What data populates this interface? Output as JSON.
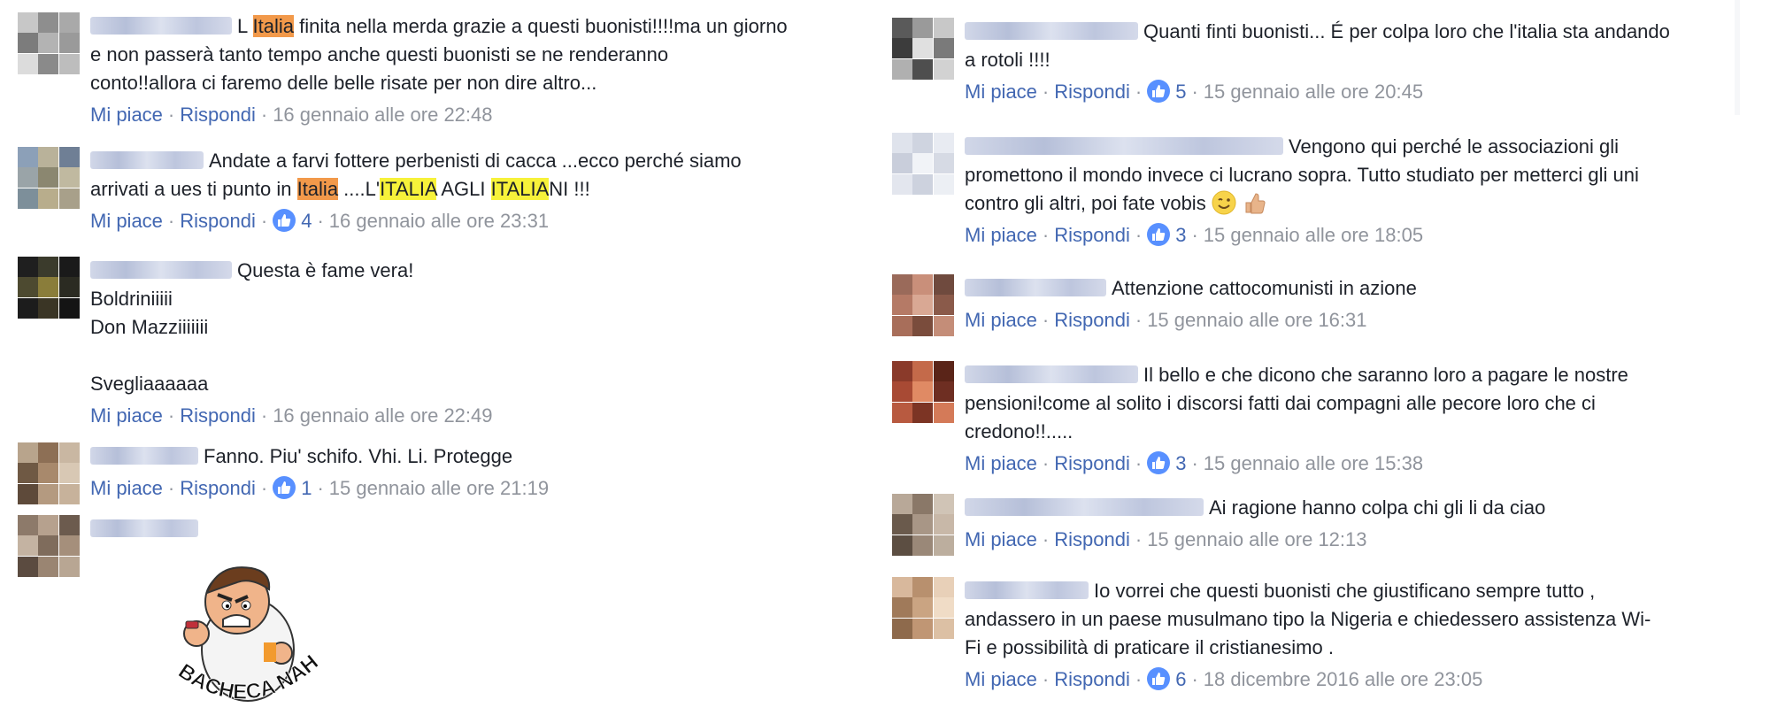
{
  "colors": {
    "link": "#4267b2",
    "meta": "#90949c",
    "like_badge": "#5890ff",
    "highlight_orange": "#f2994a",
    "highlight_yellow": "#f7f23a"
  },
  "actions": {
    "like": "Mi piace",
    "reply": "Rispondi",
    "dot": "·"
  },
  "left_comments": [
    {
      "avatar_colors": [
        "#c7c7c7",
        "#8e8e8e",
        "#a9a9a9",
        "#7c7c7c",
        "#b3b3b3",
        "#9a9a9a",
        "#dcdcdc",
        "#8a8a8a",
        "#bdbdbd"
      ],
      "lines": [
        [
          {
            "t": "L "
          },
          {
            "t": "Italia",
            "h": "o"
          },
          {
            "t": " finita nella merda grazie a questi buonisti!!!!ma un giorno"
          }
        ],
        [
          {
            "t": "e non passerà tanto tempo anche questi buonisti se ne renderanno"
          }
        ],
        [
          {
            "t": "conto!!allora ci faremo delle belle risate per non dire altro..."
          }
        ]
      ],
      "time": "16 gennaio alle ore 22:48",
      "likes": ""
    },
    {
      "avatar_colors": [
        "#8ca0b8",
        "#b9b29a",
        "#6f7f95",
        "#9aa4a8",
        "#8b8770",
        "#c0b9a0",
        "#7d8f9a",
        "#b8ad8c",
        "#a8a08a"
      ],
      "lines": [
        [
          {
            "t": "Andate a farvi fottere perbenisti di cacca ...ecco perché siamo"
          }
        ],
        [
          {
            "t": "arrivati a ues ti punto in "
          },
          {
            "t": "Italia",
            "h": "o"
          },
          {
            "t": " ....L'"
          },
          {
            "t": "ITALIA",
            "h": "y"
          },
          {
            "t": " AGLI "
          },
          {
            "t": "ITALIA",
            "h": "y"
          },
          {
            "t": "NI !!!"
          }
        ]
      ],
      "time": "16 gennaio alle ore 23:31",
      "likes": "4"
    },
    {
      "avatar_colors": [
        "#1f1f1f",
        "#3b3b2c",
        "#1a1a1a",
        "#4d4a30",
        "#8a7d3a",
        "#2b2b22",
        "#1c1c1c",
        "#3a3525",
        "#141414"
      ],
      "lines": [
        [
          {
            "t": "Questa è fame vera!"
          }
        ],
        [
          {
            "t": "Boldriniiiii"
          }
        ],
        [
          {
            "t": "Don Mazziiiiiii"
          }
        ],
        [
          {
            "t": " "
          }
        ],
        [
          {
            "t": "Svegliaaaaaa"
          }
        ]
      ],
      "time": "16 gennaio alle ore 22:49",
      "likes": ""
    },
    {
      "avatar_colors": [
        "#b8a48c",
        "#8d6f55",
        "#c9b7a2",
        "#6f5944",
        "#a8896c",
        "#d8c8b4",
        "#5e4a3a",
        "#b49a80",
        "#c7b29b"
      ],
      "lines": [
        [
          {
            "t": "Fanno. Piu' schifo. Vhi. Li. Protegge"
          }
        ]
      ],
      "time": "15 gennaio alle ore 21:19",
      "likes": "1"
    },
    {
      "avatar_colors": [
        "#8d7a6a",
        "#b6a18e",
        "#6c5b4e",
        "#c4b3a2",
        "#7f6c5c",
        "#a58f7b",
        "#5b4b40",
        "#9a8572",
        "#b8a693"
      ],
      "lines": [],
      "time": "",
      "likes": "",
      "sticker_text": "BACHECA NAHI!"
    }
  ],
  "right_comments": [
    {
      "avatar_colors": [
        "#5a5a5a",
        "#9a9a9a",
        "#c8c8c8",
        "#3c3c3c",
        "#e0e0e0",
        "#7a7a7a",
        "#b0b0b0",
        "#4e4e4e",
        "#d2d2d2"
      ],
      "lines": [
        [
          {
            "t": "Quanti finti buonisti... É per colpa loro che l'italia sta andando"
          }
        ],
        [
          {
            "t": "a rotoli !!!!"
          }
        ]
      ],
      "time": "15 gennaio alle ore 20:45",
      "likes": "5"
    },
    {
      "avatar_colors": [
        "#dfe3ec",
        "#cfd4e0",
        "#e8ebf2",
        "#c9cedb",
        "#f1f3f7",
        "#d6dae4",
        "#e3e6ee",
        "#cdd2de",
        "#eceff4"
      ],
      "lines": [
        [
          {
            "t": "Vengono qui perché le associazioni gli"
          }
        ],
        [
          {
            "t": "promettono il mondo invece ci lucrano sopra. Tutto studiato per metterci gli uni"
          }
        ],
        [
          {
            "t": "contro gli altri, poi fate vobis"
          }
        ]
      ],
      "time": "15 gennaio alle ore 18:05",
      "likes": "3",
      "emoji": true
    },
    {
      "avatar_colors": [
        "#9a6a5a",
        "#c98f7a",
        "#6f4a3e",
        "#b57a66",
        "#d9a894",
        "#8a5a4a",
        "#a86e5a",
        "#7a4c3c",
        "#c48d78"
      ],
      "lines": [
        [
          {
            "t": "Attenzione cattocomunisti in azione"
          }
        ]
      ],
      "time": "15 gennaio alle ore 16:31",
      "likes": ""
    },
    {
      "avatar_colors": [
        "#8a3a2a",
        "#c46a4a",
        "#5a2418",
        "#a84a34",
        "#e08a64",
        "#6e2e22",
        "#b85a40",
        "#7c3424",
        "#d47a58"
      ],
      "lines": [
        [
          {
            "t": "Il bello e che dicono che saranno loro a pagare le nostre"
          }
        ],
        [
          {
            "t": "pensioni!come al solito i discorsi fatti dai compagni alle pecore loro che ci"
          }
        ],
        [
          {
            "t": "credono!!....."
          }
        ]
      ],
      "time": "15 gennaio alle ore 15:38",
      "likes": "3"
    },
    {
      "avatar_colors": [
        "#b8a898",
        "#8a7868",
        "#d0c4b6",
        "#6a5a4c",
        "#a89686",
        "#c8b8a8",
        "#5c4e42",
        "#9a8878",
        "#bcae9e"
      ],
      "lines": [
        [
          {
            "t": "Ai ragione hanno colpa chi gli li da ciao"
          }
        ]
      ],
      "time": "15 gennaio alle ore 12:13",
      "likes": ""
    },
    {
      "avatar_colors": [
        "#d8b89c",
        "#b8906e",
        "#e8d0b8",
        "#a07a5a",
        "#caa482",
        "#f0dcc6",
        "#8e6a4c",
        "#c09674",
        "#dcc0a4"
      ],
      "lines": [
        [
          {
            "t": "Io vorrei che questi buonisti che giustificano sempre tutto ,"
          }
        ],
        [
          {
            "t": "andassero in un paese musulmano tipo la Nigeria e chiedessero assistenza Wi-"
          }
        ],
        [
          {
            "t": "Fi e possibilità di praticare il cristianesimo ."
          }
        ]
      ],
      "time": "18 dicembre 2016 alle ore 23:05",
      "likes": "6"
    }
  ]
}
